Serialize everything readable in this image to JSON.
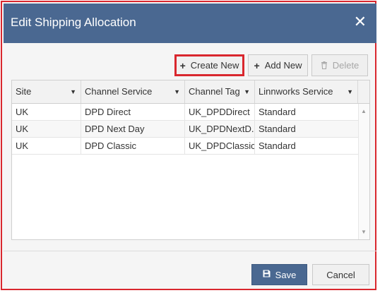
{
  "dialog": {
    "title": "Edit Shipping Allocation",
    "close_glyph": "✕"
  },
  "toolbar": {
    "create_new": {
      "icon": "plus-icon",
      "glyph": "✚",
      "label": "Create New"
    },
    "add_new": {
      "icon": "plus-icon",
      "glyph": "✚",
      "label": "Add New"
    },
    "delete": {
      "icon": "trash-icon",
      "glyph": "🗑",
      "label": "Delete"
    }
  },
  "grid": {
    "columns": [
      "Site",
      "Channel Service",
      "Channel Tag",
      "Linnworks Service"
    ],
    "rows": [
      [
        "UK",
        "DPD Direct",
        "UK_DPDDirect",
        "Standard"
      ],
      [
        "UK",
        "DPD Next Day",
        "UK_DPDNextD...",
        "Standard"
      ],
      [
        "UK",
        "DPD Classic",
        "UK_DPDClassic",
        "Standard"
      ]
    ]
  },
  "footer": {
    "save": {
      "icon": "save-icon",
      "glyph": "💾",
      "label": "Save"
    },
    "cancel": {
      "label": "Cancel"
    }
  },
  "colors": {
    "titlebar": "#4a6891",
    "highlight": "#d9272e",
    "save_button": "#4a6891"
  }
}
